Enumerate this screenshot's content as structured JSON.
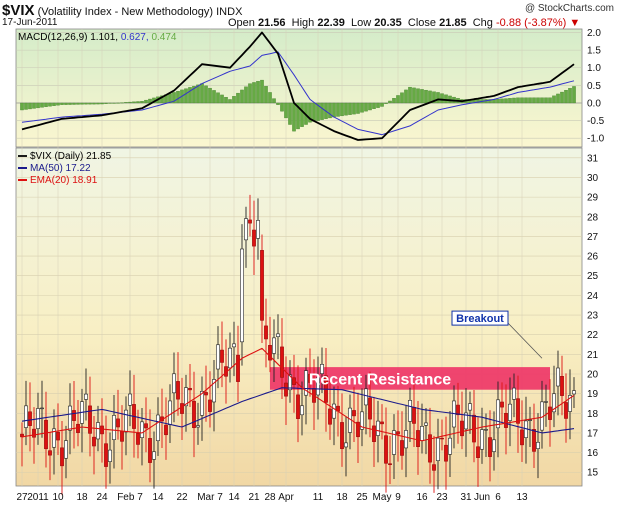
{
  "header": {
    "symbol": "$VIX",
    "name": "(Volatility Index - New Methodology)",
    "exchange": "INDX",
    "date": "17-Jun-2011",
    "watermark": "@ StockCharts.com",
    "open_label": "Open",
    "open": "21.56",
    "high_label": "High",
    "high": "22.39",
    "low_label": "Low",
    "low": "20.35",
    "close_label": "Close",
    "close": "21.85",
    "chg_label": "Chg",
    "chg": "-0.88 (-3.87%)"
  },
  "colors": {
    "price_line": "#1a1a1a",
    "ma50": "#1a1a8c",
    "ema20": "#dd1111",
    "up_candle": "#ffffff",
    "down_candle": "#dd1111",
    "macd_line": "#000000",
    "signal_line": "#3333cc",
    "hist": "#66aa44",
    "resistance_band": "#ee3366",
    "resistance_text": "#ffffff",
    "breakout_box": "#1133aa"
  },
  "chart_data": [
    {
      "type": "line",
      "panel": "macd",
      "legend": "MACD(12,26,9)",
      "legend_values": {
        "macd": "1.101",
        "signal": "0.627",
        "histogram": "0.474"
      },
      "ylim": [
        -1.25,
        2.1
      ],
      "yticks": [
        "2.0",
        "1.5",
        "1.0",
        "0.5",
        "0.0",
        "-0.5",
        "-1.0"
      ],
      "x_index": [
        0,
        10,
        20,
        30,
        38,
        45,
        52,
        57,
        60,
        64,
        68,
        72,
        78,
        84,
        90,
        97,
        104,
        110,
        118,
        124,
        132,
        138
      ],
      "series": [
        {
          "key": "macd",
          "values": [
            -0.75,
            -0.45,
            -0.35,
            -0.15,
            0.35,
            1.1,
            1.0,
            1.6,
            2.0,
            1.4,
            0.0,
            -0.45,
            -0.8,
            -1.05,
            -1.0,
            -0.2,
            0.1,
            0.05,
            0.2,
            0.45,
            0.6,
            1.1
          ]
        },
        {
          "key": "signal",
          "values": [
            -0.55,
            -0.4,
            -0.32,
            -0.2,
            0.05,
            0.55,
            0.9,
            1.05,
            1.35,
            1.45,
            0.8,
            0.1,
            -0.4,
            -0.75,
            -0.9,
            -0.65,
            -0.2,
            -0.05,
            0.1,
            0.3,
            0.45,
            0.63
          ]
        }
      ]
    },
    {
      "type": "candlestick",
      "panel": "price",
      "legend": [
        "$VIX (Daily) 21.85",
        "MA(50) 17.22",
        "EMA(20) 18.91"
      ],
      "ylim": [
        14.3,
        31.5
      ],
      "yticks": [
        31,
        30,
        29,
        28,
        27,
        26,
        25,
        24,
        23,
        22,
        21,
        20,
        19,
        18,
        17,
        16,
        15
      ],
      "x_tick_labels": [
        "27",
        "2011",
        "10",
        "18",
        "24",
        "Feb 7",
        "14",
        "22",
        "Mar 7",
        "14",
        "21",
        "28",
        "Apr",
        "11",
        "18",
        "25",
        "May",
        "9",
        "16",
        "23",
        "31",
        "Jun",
        "6",
        "13"
      ],
      "x_tick_index": [
        0,
        4,
        9,
        15,
        20,
        27,
        34,
        40,
        47,
        53,
        58,
        62,
        66,
        74,
        80,
        85,
        90,
        94,
        100,
        105,
        111,
        115,
        119,
        125
      ],
      "ma50": {
        "x_index": [
          0,
          20,
          40,
          55,
          65,
          80,
          100,
          115,
          130,
          138
        ],
        "values": [
          17.6,
          18.2,
          17.3,
          18.6,
          19.3,
          19.2,
          18.2,
          17.8,
          17.0,
          17.22
        ]
      },
      "ema20": {
        "x_index": [
          0,
          15,
          30,
          45,
          55,
          60,
          70,
          85,
          100,
          115,
          130,
          138
        ],
        "values": [
          16.8,
          17.3,
          17.0,
          19.0,
          20.8,
          21.3,
          19.3,
          17.3,
          16.6,
          17.3,
          17.8,
          18.91
        ]
      },
      "annotations": [
        {
          "text": "Recent Resistance",
          "kind": "band",
          "y_range": [
            19.2,
            20.35
          ],
          "x_index_range": [
            62,
            132
          ]
        },
        {
          "text": "Breakout",
          "kind": "label",
          "target_x_index": 130,
          "target_y": 20.8
        }
      ]
    }
  ]
}
